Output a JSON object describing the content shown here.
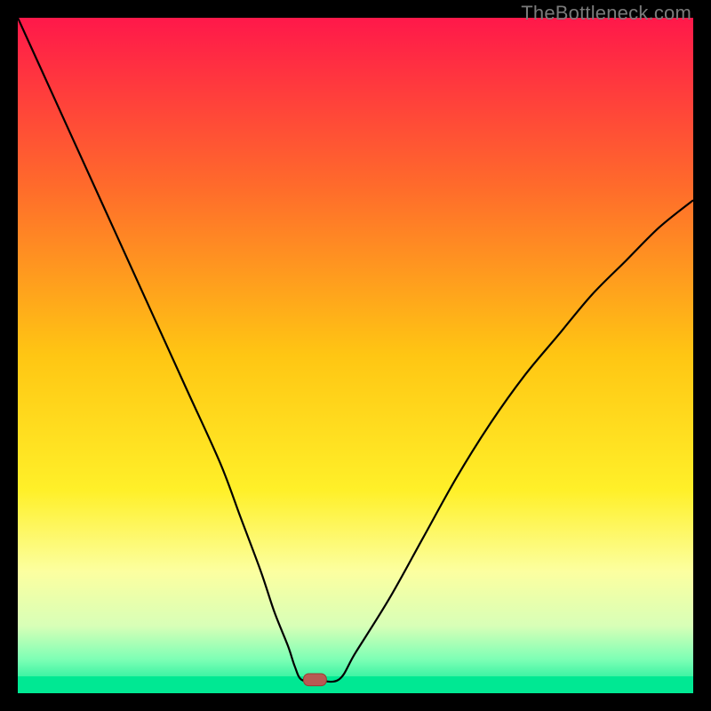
{
  "watermark": "TheBottleneck.com",
  "chart_data": {
    "type": "line",
    "title": "",
    "xlabel": "",
    "ylabel": "",
    "xlim": [
      0,
      100
    ],
    "ylim": [
      0,
      100
    ],
    "background_gradient": {
      "stops": [
        {
          "offset": 0.0,
          "color": "#ff184a"
        },
        {
          "offset": 0.25,
          "color": "#ff6b2b"
        },
        {
          "offset": 0.5,
          "color": "#ffc613"
        },
        {
          "offset": 0.7,
          "color": "#fff029"
        },
        {
          "offset": 0.82,
          "color": "#fcffa0"
        },
        {
          "offset": 0.9,
          "color": "#d8ffb7"
        },
        {
          "offset": 0.95,
          "color": "#7dffb5"
        },
        {
          "offset": 1.0,
          "color": "#00e893"
        }
      ]
    },
    "green_band": {
      "y0": 0,
      "y1": 2.5,
      "color": "#00e893"
    },
    "series": [
      {
        "name": "bottleneck-curve",
        "type": "line",
        "color": "#000000",
        "width": 2.2,
        "x": [
          0,
          5,
          10,
          15,
          20,
          25,
          30,
          33,
          36,
          38,
          40,
          41,
          42,
          44,
          47.5,
          50,
          55,
          60,
          65,
          70,
          75,
          80,
          85,
          90,
          95,
          100
        ],
        "y": [
          100,
          89,
          78,
          67,
          56,
          45,
          34,
          26,
          18,
          12,
          7,
          4,
          2,
          2,
          2,
          6,
          14,
          23,
          32,
          40,
          47,
          53,
          59,
          64,
          69,
          73
        ]
      }
    ],
    "valley_plateau": {
      "x0": 41,
      "x1": 47.5,
      "y": 2
    },
    "marker": {
      "name": "optimal-point",
      "shape": "rounded-rect",
      "x": 44,
      "y": 2,
      "width": 3.4,
      "height": 1.8,
      "fill": "#b85a53",
      "stroke": "#9c3a33"
    }
  }
}
